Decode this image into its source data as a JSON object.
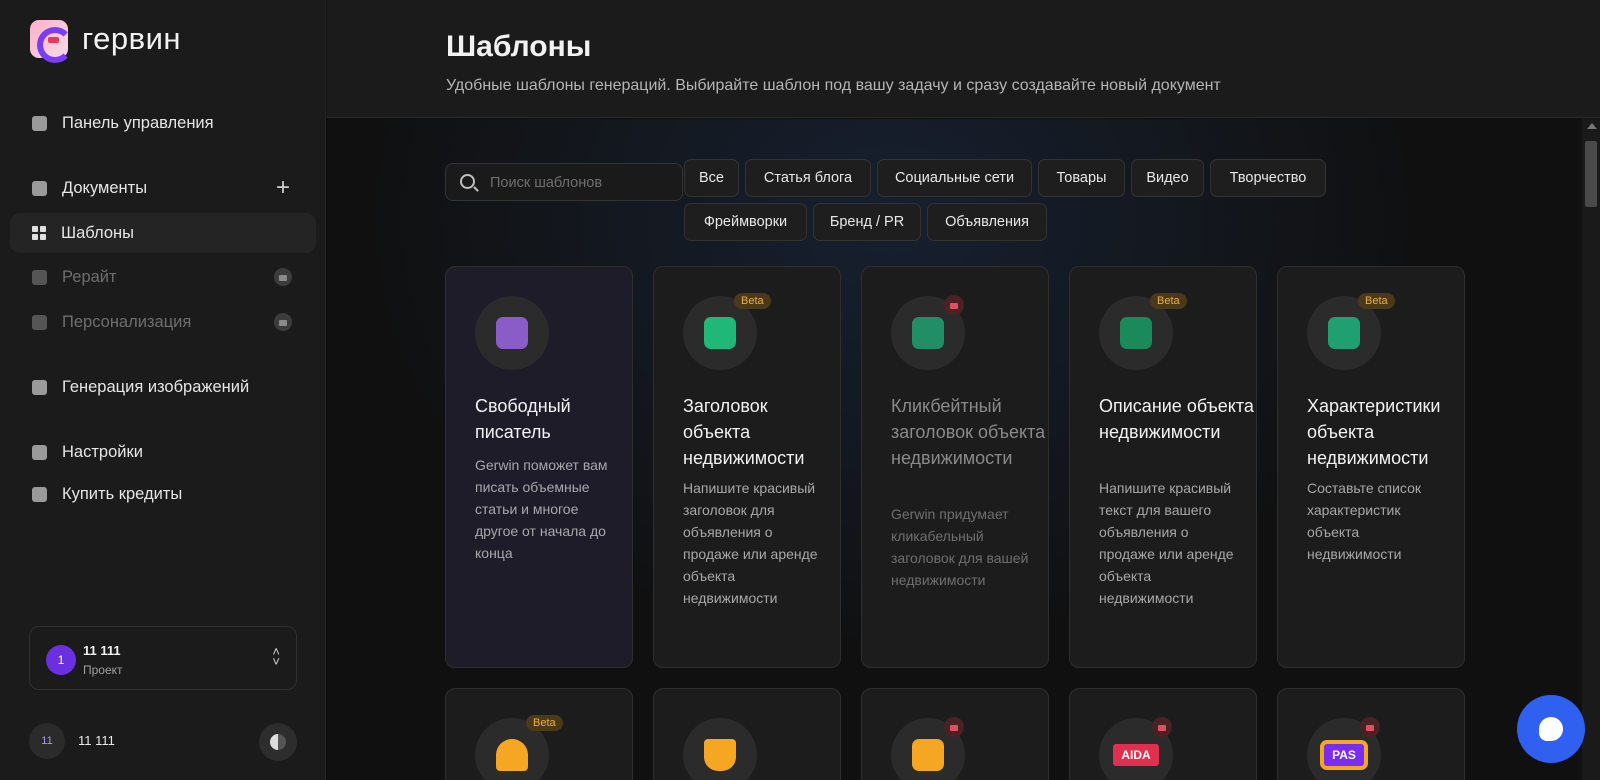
{
  "app": {
    "logo_text": "гервин"
  },
  "sidebar": {
    "items": [
      {
        "label": "Панель управления",
        "icon": "home-icon"
      },
      {
        "label": "Документы",
        "icon": "document-icon"
      },
      {
        "label": "Шаблоны",
        "icon": "grid-icon"
      },
      {
        "label": "Рерайт",
        "icon": "rewrite-icon",
        "locked": true
      },
      {
        "label": "Персонализация",
        "icon": "personalization-icon",
        "locked": true
      },
      {
        "label": "Генерация изображений",
        "icon": "image-icon"
      },
      {
        "label": "Настройки",
        "icon": "settings-icon"
      },
      {
        "label": "Купить кредиты",
        "icon": "dollar-icon"
      }
    ],
    "add_symbol": "+",
    "project": {
      "badge": "1",
      "name": "11 111",
      "label": "Проект"
    },
    "user": {
      "avatar": "11",
      "name": "11 111"
    }
  },
  "header": {
    "title": "Шаблоны",
    "subtitle": "Удобные шаблоны генераций. Выбирайте шаблон под вашу задачу и сразу создавайте новый документ"
  },
  "search": {
    "placeholder": "Поиск шаблонов",
    "value": ""
  },
  "filters": [
    "Все",
    "Статья блога",
    "Социальные сети",
    "Товары",
    "Видео",
    "Творчество",
    "Фреймворки",
    "Бренд / PR",
    "Объявления"
  ],
  "cards": [
    {
      "title": "Свободный писатель",
      "description": "Gerwin поможет вам писать объемные статьи и многое другое от начала до конца",
      "icon": "document-icon",
      "color": "#8a5cc8"
    },
    {
      "title": "Заголовок объекта недвижимости",
      "description": "Напишите красивый заголовок для объявления о продаже или аренде объекта недвижимости",
      "icon": "building-icon",
      "badge": "Beta",
      "color": "#20b878"
    },
    {
      "title": "Кликбейтный заголовок объекта недвижимости",
      "description": "Gerwin придумает кликабельный заголовок для вашей недвижимости",
      "icon": "building-icon",
      "locked": true,
      "color": "#20a070"
    },
    {
      "title": "Описание объекта недвижимости",
      "description": "Напишите красивый текст для вашего объявления о продаже или аренде объекта недвижимости",
      "icon": "house-icon",
      "badge": "Beta",
      "color": "#1a8a5a"
    },
    {
      "title": "Характеристики объекта недвижимости",
      "description": "Составьте список характеристик объекта недвижимости",
      "icon": "buildings-icon",
      "badge": "Beta",
      "color": "#20a070"
    }
  ],
  "cards_row2": [
    {
      "icon": "ghost-icon",
      "badge": "Beta",
      "color": "#f5a623"
    },
    {
      "icon": "basket-icon",
      "color": "#f5a623"
    },
    {
      "icon": "calendar-icon",
      "locked": true,
      "color": "#f5a623"
    },
    {
      "icon": "aida-icon",
      "label": "AIDA",
      "locked": true,
      "color": "#e03050"
    },
    {
      "icon": "pas-icon",
      "label": "PAS",
      "locked": true,
      "color": "#f5a623"
    }
  ],
  "colors": {
    "accent": "#6a30e0",
    "chat": "#2f60f0",
    "beta": "#f0b040",
    "lock": "#e05060"
  }
}
